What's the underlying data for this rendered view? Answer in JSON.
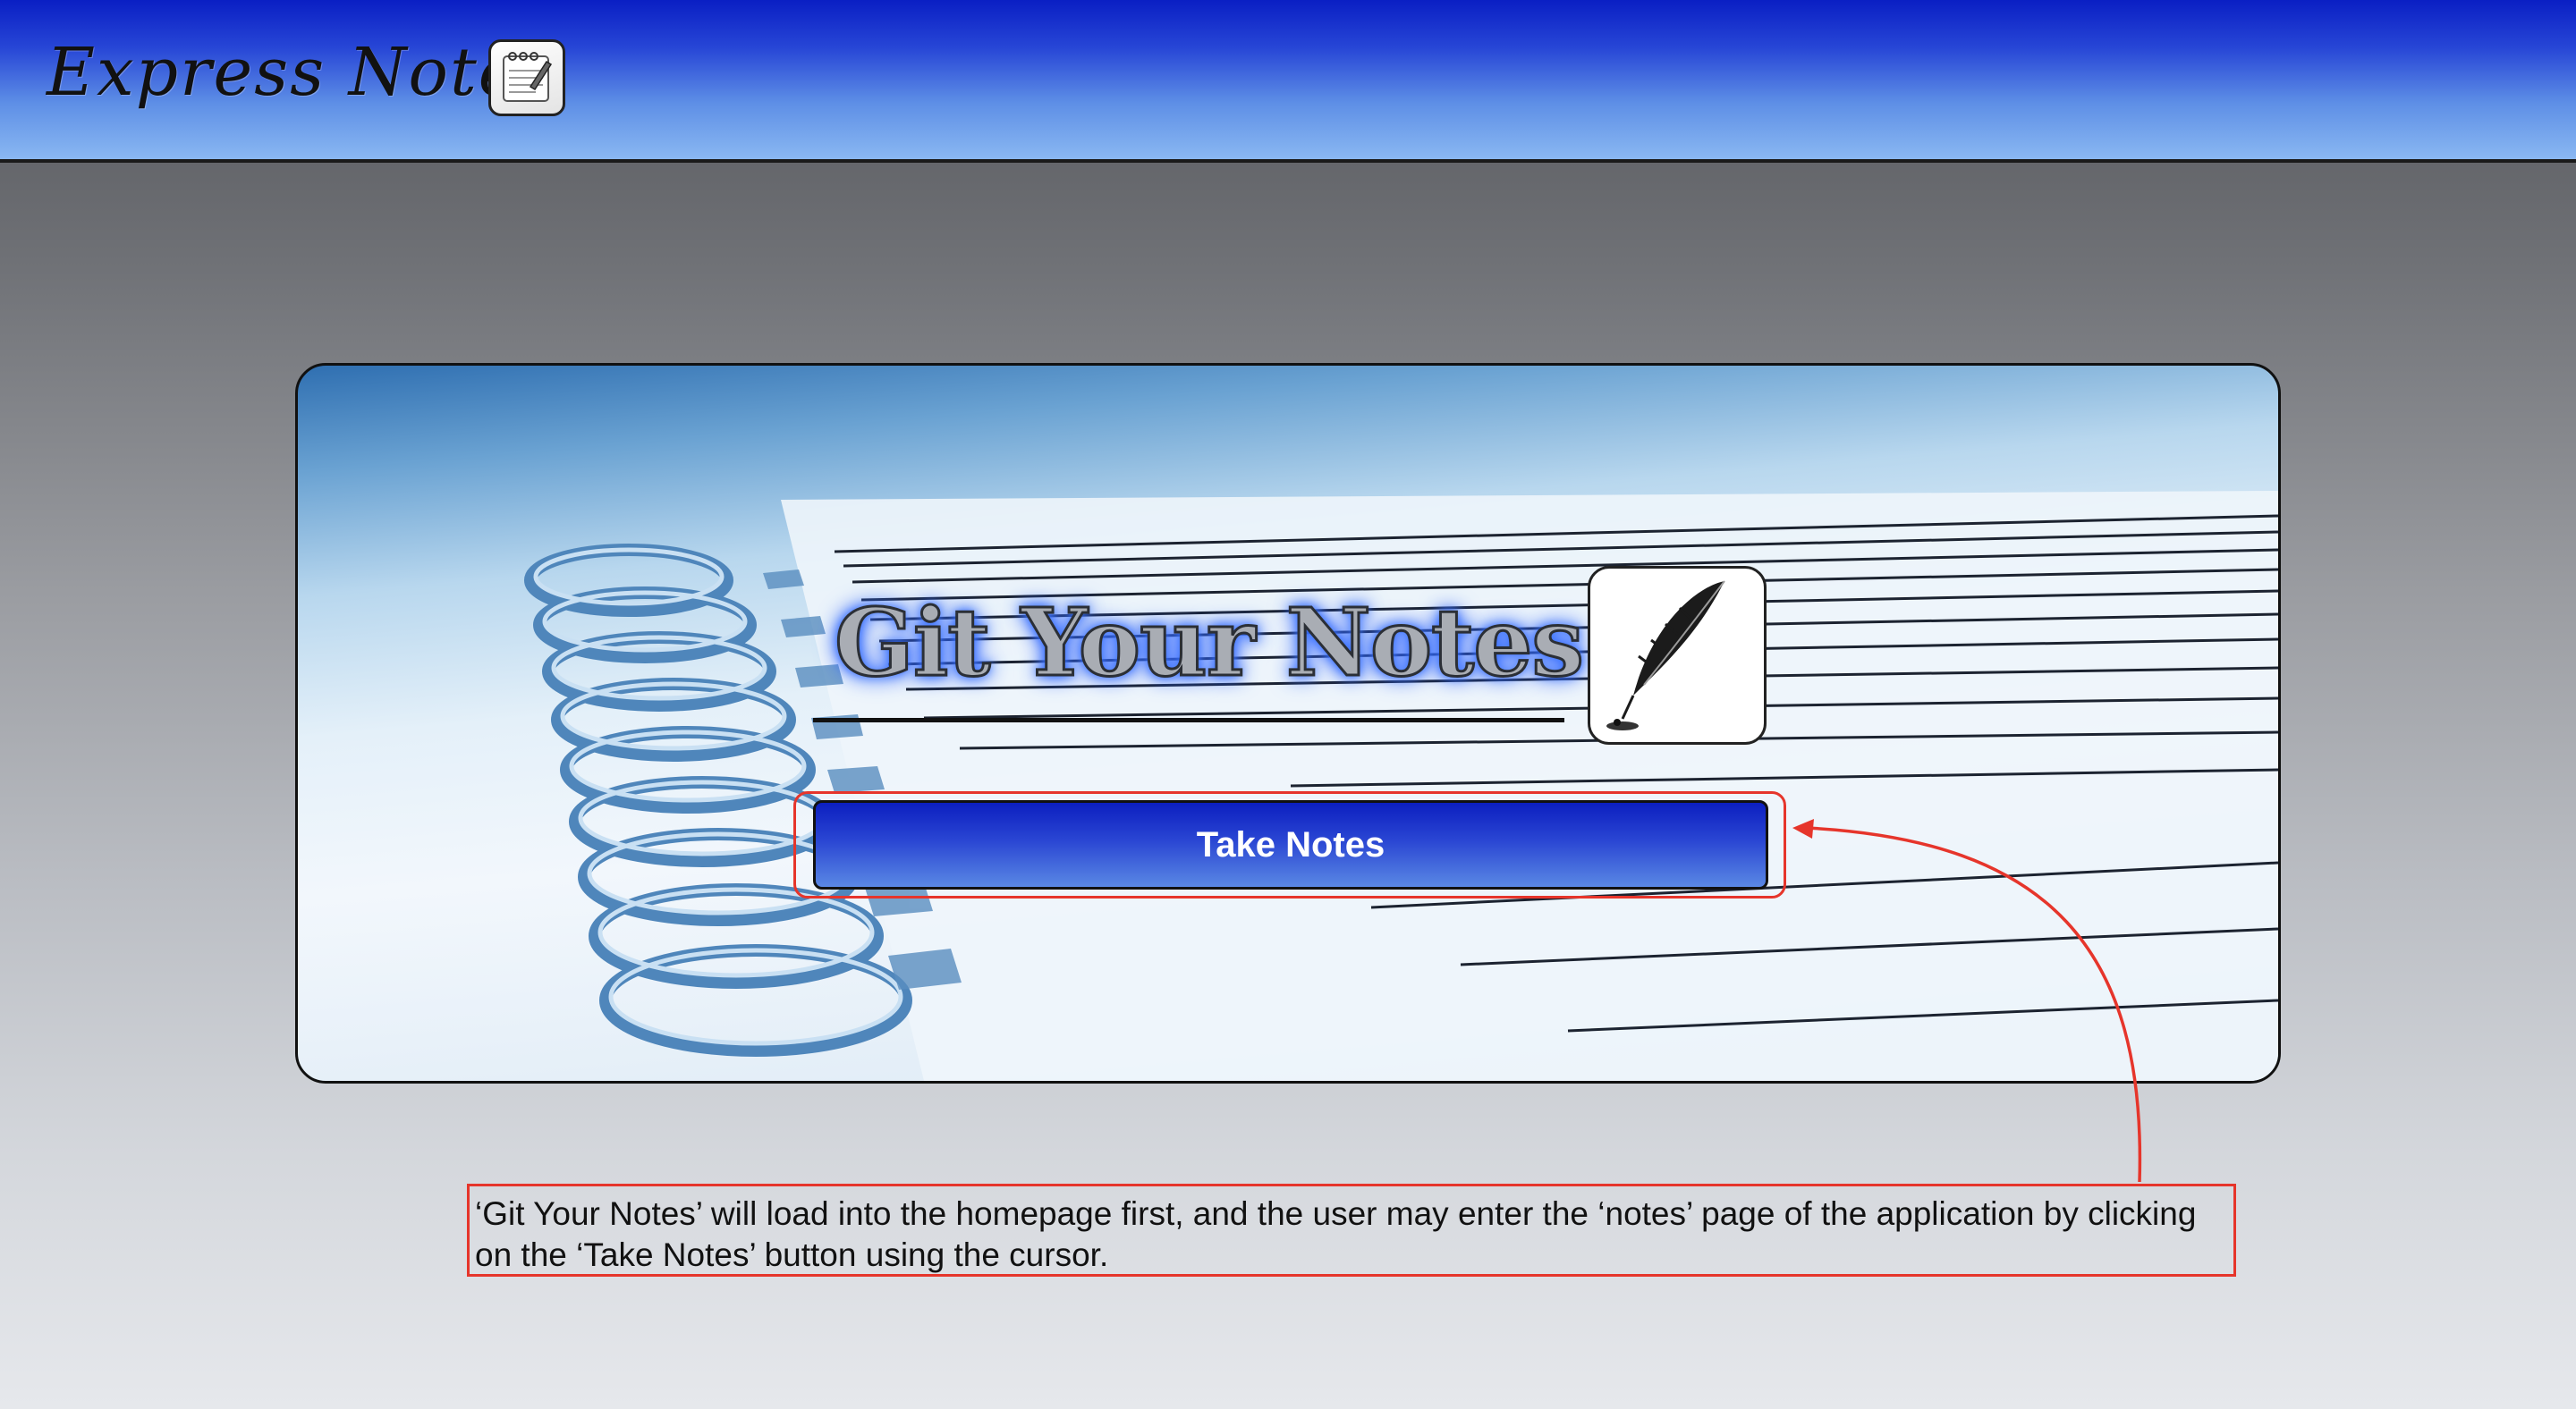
{
  "header": {
    "brand_title": "Express Notes",
    "brand_icon": "notepad-app-icon"
  },
  "hero": {
    "title": "Git Your Notes",
    "title_glow_color": "#3b73ff",
    "quill_icon": "quill-pen-icon",
    "take_notes_label": "Take Notes",
    "button_color": "#1c36cf",
    "highlight_color": "#e6352b"
  },
  "annotation": {
    "text": "‘Git Your Notes’ will load into the homepage first, and the user may enter the ‘notes’ page of the application by clicking on the ‘Take Notes’ button using the cursor.",
    "border_color": "#e6352b"
  }
}
